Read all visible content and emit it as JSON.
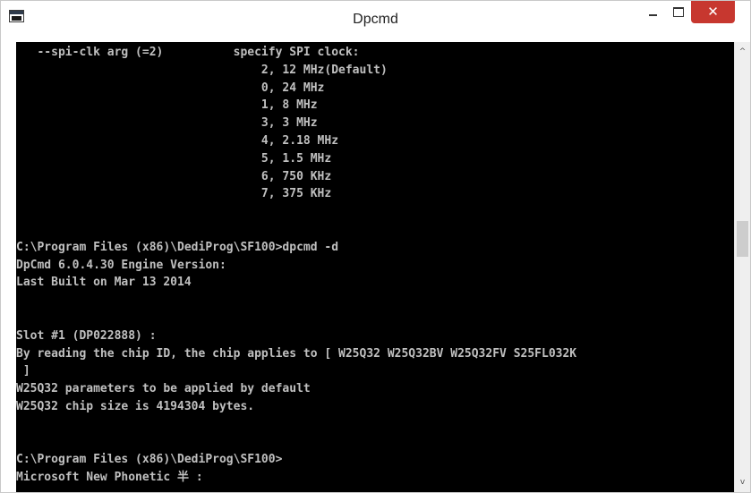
{
  "window": {
    "title": "Dpcmd",
    "minimize_label": "–",
    "maximize_label": "□",
    "close_label": "✕"
  },
  "icons": {
    "app": "console-window-icon",
    "scroll_up": "chevron-up-icon",
    "scroll_down": "chevron-down-icon"
  },
  "scroll": {
    "up_glyph": "^",
    "down_glyph": "v"
  },
  "console": {
    "lines": [
      "   --spi-clk arg (=2)          specify SPI clock:",
      "                                   2, 12 MHz(Default)",
      "                                   0, 24 MHz",
      "                                   1, 8 MHz",
      "                                   3, 3 MHz",
      "                                   4, 2.18 MHz",
      "                                   5, 1.5 MHz",
      "                                   6, 750 KHz",
      "                                   7, 375 KHz",
      "",
      "",
      "C:\\Program Files (x86)\\DediProg\\SF100>dpcmd -d",
      "DpCmd 6.0.4.30 Engine Version:",
      "Last Built on Mar 13 2014",
      "",
      "",
      "Slot #1 (DP022888) :",
      "By reading the chip ID, the chip applies to [ W25Q32 W25Q32BV W25Q32FV S25FL032K",
      " ]",
      "W25Q32 parameters to be applied by default",
      "W25Q32 chip size is 4194304 bytes.",
      "",
      "",
      "C:\\Program Files (x86)\\DediProg\\SF100>",
      "Microsoft New Phonetic 半 :"
    ]
  }
}
